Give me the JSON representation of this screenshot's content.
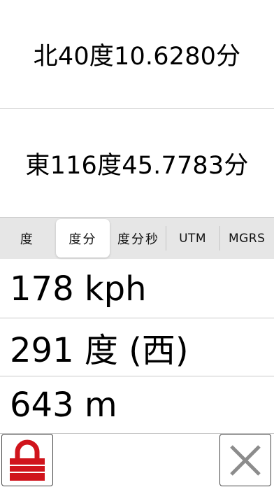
{
  "latitude": "北40度10.6280分",
  "longitude": "東116度45.7783分",
  "format_tabs": [
    {
      "label": "度",
      "selected": false
    },
    {
      "label": "度分",
      "selected": true
    },
    {
      "label": "度分秒",
      "selected": false
    },
    {
      "label": "UTM",
      "selected": false
    },
    {
      "label": "MGRS",
      "selected": false
    }
  ],
  "speed": "178 kph",
  "heading": "291 度 (西)",
  "altitude": "643 m",
  "buttons": {
    "lock_icon": "lock-icon",
    "close_icon": "close-icon"
  },
  "colors": {
    "lock_red": "#d0141c",
    "close_gray": "#8c8c8c",
    "segment_bg": "#e6e6e6",
    "separator": "#c8c8c8"
  }
}
